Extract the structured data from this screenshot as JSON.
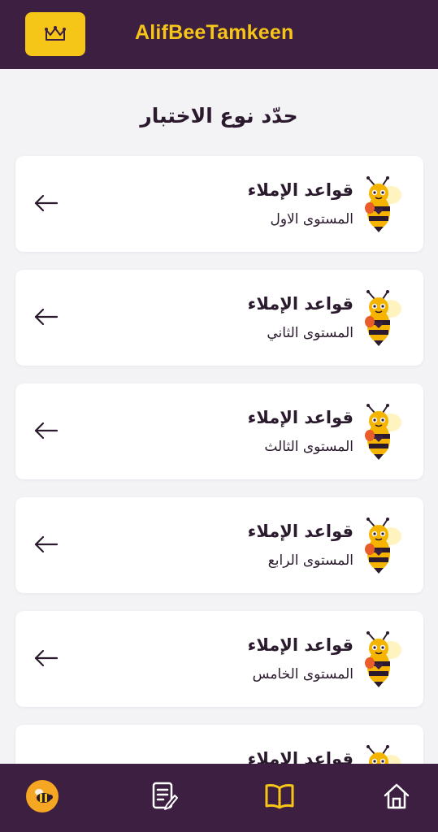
{
  "header": {
    "brand": "AlifBeeTamkeen",
    "crown_icon": "crown-icon",
    "accent": "#f5c518",
    "background": "#3d1f41"
  },
  "page": {
    "title": "حدّد نوع الاختبار"
  },
  "items": [
    {
      "title": "قواعد الإملاء",
      "subtitle": "المستوى الاول"
    },
    {
      "title": "قواعد الإملاء",
      "subtitle": "المستوى الثاني"
    },
    {
      "title": "قواعد الإملاء",
      "subtitle": "المستوى الثالث"
    },
    {
      "title": "قواعد الإملاء",
      "subtitle": "المستوى الرابع"
    },
    {
      "title": "قواعد الإملاء",
      "subtitle": "المستوى الخامس"
    },
    {
      "title": "قواعد الإملاء",
      "subtitle": ""
    }
  ],
  "bottom_nav": {
    "items": [
      {
        "icon": "bee-avatar-icon",
        "active": false
      },
      {
        "icon": "notes-icon",
        "active": false
      },
      {
        "icon": "book-icon",
        "active": true
      },
      {
        "icon": "home-icon",
        "active": false
      }
    ],
    "active_color": "#f5c518",
    "inactive_color": "#ffffff"
  }
}
